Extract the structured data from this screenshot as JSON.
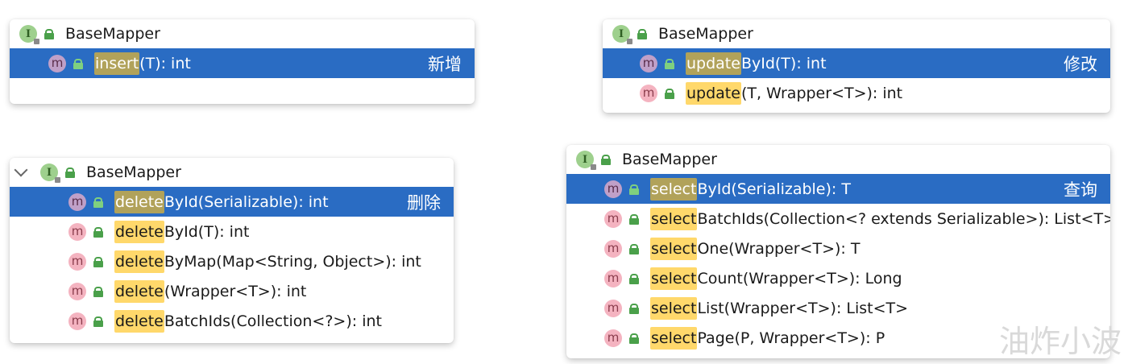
{
  "interface_name": "BaseMapper",
  "iface_badge": "I",
  "method_badge": "m",
  "panels": {
    "insert": {
      "label": "新增",
      "rows": [
        {
          "hl": "insert",
          "rest": "(T): int"
        }
      ]
    },
    "update": {
      "label": "修改",
      "rows": [
        {
          "hl": "update",
          "rest": "ById(T): int"
        },
        {
          "hl": "update",
          "rest": "(T, Wrapper<T>): int"
        }
      ]
    },
    "delete": {
      "label": "删除",
      "rows": [
        {
          "hl": "delete",
          "rest": "ById(Serializable): int"
        },
        {
          "hl": "delete",
          "rest": "ById(T): int"
        },
        {
          "hl": "delete",
          "rest": "ByMap(Map<String, Object>): int"
        },
        {
          "hl": "delete",
          "rest": "(Wrapper<T>): int"
        },
        {
          "hl": "delete",
          "rest": "BatchIds(Collection<?>): int"
        }
      ]
    },
    "select": {
      "label": "查询",
      "rows": [
        {
          "hl": "select",
          "rest": "ById(Serializable): T"
        },
        {
          "hl": "select",
          "rest": "BatchIds(Collection<? extends Serializable>): List<T>"
        },
        {
          "hl": "select",
          "rest": "One(Wrapper<T>): T"
        },
        {
          "hl": "select",
          "rest": "Count(Wrapper<T>): Long"
        },
        {
          "hl": "select",
          "rest": "List(Wrapper<T>): List<T>"
        },
        {
          "hl": "select",
          "rest": "Page(P, Wrapper<T>): P"
        }
      ]
    }
  },
  "watermark": "油炸小波",
  "colors": {
    "selection": "#2a6cc3",
    "match_highlight": "#ffd86b",
    "interface_badge": "#9ed08d",
    "method_badge": "#f4b3c0",
    "visibility_icon": "#4aa04a"
  }
}
